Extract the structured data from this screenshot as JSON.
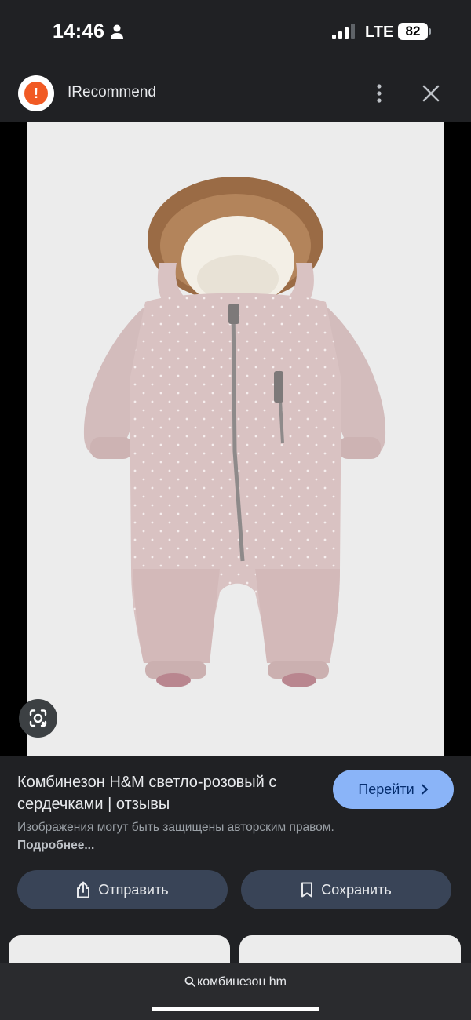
{
  "status_bar": {
    "time": "14:46",
    "network": "LTE",
    "battery": "82"
  },
  "source": {
    "logo_letter": "!",
    "name": "IRecommend"
  },
  "result": {
    "title": "Комбинезон H&M светло-розовый с сердечками | отзывы",
    "go_label": "Перейти",
    "copyright_text": "Изображения могут быть защищены авторским правом.",
    "more_link": "Подробнее...",
    "share_label": "Отправить",
    "save_label": "Сохранить"
  },
  "bottom": {
    "search_query": "комбинезон hm"
  },
  "colors": {
    "background": "#202124",
    "accent_button": "#8ab4f8",
    "secondary_button": "#394457",
    "logo": "#f15a24",
    "suit": "#d9c2c2"
  },
  "icons": [
    "person-icon",
    "signal-icon",
    "more-vert-icon",
    "close-icon",
    "lens-icon",
    "chevron-right-icon",
    "share-icon",
    "bookmark-icon",
    "search-icon"
  ]
}
